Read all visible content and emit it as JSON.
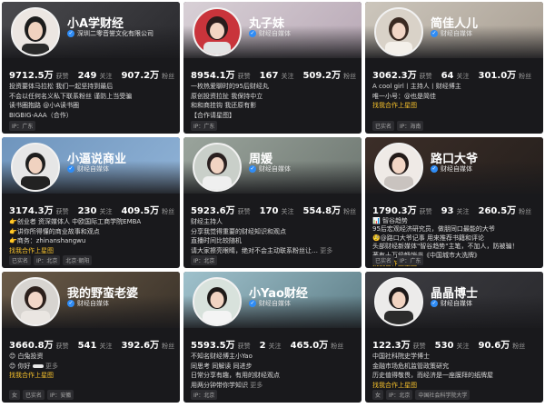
{
  "cards": [
    {
      "name": "小A学财经",
      "verify": "深圳二零音誉文化有限公司",
      "stats": [
        {
          "value": "9712.5万",
          "label": "获赞"
        },
        {
          "value": "249",
          "label": "关注"
        },
        {
          "value": "907.2万",
          "label": "粉丝"
        }
      ],
      "bio": [
        "投资要体马拉松 我们一起坚持到最后",
        "不会以任何名义私下联系粉丝 谨防上当受骗",
        "读书圈抱路 @小A读书圈",
        "BIGBIG-AAA（合作）"
      ],
      "coop": "",
      "tags": [
        "IP：广东"
      ]
    },
    {
      "name": "丸子妹",
      "verify": "财经自媒体",
      "stats": [
        {
          "value": "8954.1万",
          "label": "获赞"
        },
        {
          "value": "167",
          "label": "关注"
        },
        {
          "value": "509.2万",
          "label": "粉丝"
        }
      ],
      "bio": [
        "一枚热爱聊时的95后财经丸",
        "原创投资拉扯 我保持中立",
        "和和商挂钩 我还原有影",
        "【合作请星图】"
      ],
      "coop": "",
      "tags": [
        "IP：广东"
      ]
    },
    {
      "name": "简佳人儿",
      "verify": "财经自媒体",
      "stats": [
        {
          "value": "3062.3万",
          "label": "获赞"
        },
        {
          "value": "64",
          "label": "关注"
        },
        {
          "value": "301.0万",
          "label": "粉丝"
        }
      ],
      "bio": [
        "A cool girl丨主持人丨财经博主",
        "唯一小号：@也是简佳"
      ],
      "coop": "找我合作上星图",
      "tags": [
        "已实名",
        "IP：海南"
      ]
    },
    {
      "name": "小逼说商业",
      "verify": "财经自媒体",
      "stats": [
        {
          "value": "3174.3万",
          "label": "获赞"
        },
        {
          "value": "230",
          "label": "关注"
        },
        {
          "value": "409.5万",
          "label": "粉丝"
        }
      ],
      "bio": [
        "👉创业者 资深媒体人 中欧国际工商学院EMBA",
        "👉讲你所得懂的商业故事和观点",
        "👉商务：zhinanshangwu"
      ],
      "coop": "找我合作上星图",
      "tags": [
        "已实名",
        "IP：北京",
        "北京·朝阳"
      ]
    },
    {
      "name": "周媛",
      "verify": "财经自媒体",
      "stats": [
        {
          "value": "5923.6万",
          "label": "获赞"
        },
        {
          "value": "170",
          "label": "关注"
        },
        {
          "value": "554.8万",
          "label": "粉丝"
        }
      ],
      "bio": [
        "财经主持人",
        "分享我觉得重要的财经知识和观点",
        "直播时间比较随机",
        "请大家擦亮眼睛，绝对不会主动联系粉丝让…"
      ],
      "more": "更多",
      "coop": "",
      "tags": [
        "IP：北京"
      ]
    },
    {
      "name": "路口大爷",
      "verify": "财经自媒体",
      "stats": [
        {
          "value": "1790.3万",
          "label": "获赞"
        },
        {
          "value": "93",
          "label": "关注"
        },
        {
          "value": "260.5万",
          "label": "粉丝"
        }
      ],
      "bio": [
        "📊 智谷趋势",
        "95后宏观经济研究员，做朋同口最能的大爷",
        "🧐@路口大爷记事 用来推荐书籍和评论",
        "头部财经新媒体\"智谷趋势\"主笔，不加人，防被骗！",
        "著有十万级畅销书《中国城市大洗牌》"
      ],
      "coop": "找我合作上星图",
      "tags": [
        "已实名",
        "IP：广东"
      ]
    },
    {
      "name": "我的野蛮老婆",
      "verify": "财经自媒体",
      "stats": [
        {
          "value": "3660.8万",
          "label": "获赞"
        },
        {
          "value": "541",
          "label": "关注"
        },
        {
          "value": "392.6万",
          "label": "粉丝"
        }
      ],
      "bio": [
        "😊 白兔投资",
        "😊 你好",
        "更多"
      ],
      "coop": "找我合作上星图",
      "tags": [
        "女",
        "已实名",
        "IP：安徽"
      ]
    },
    {
      "name": "小Yao财经",
      "verify": "财经自媒体",
      "stats": [
        {
          "value": "5593.5万",
          "label": "获赞"
        },
        {
          "value": "2",
          "label": "关注"
        },
        {
          "value": "465.0万",
          "label": "粉丝"
        }
      ],
      "bio": [
        "不知名财经博主小Yao",
        "同思考 同解读 同进步",
        "日常分享有趣，有用的财经观点",
        "用两分钟带你学知识"
      ],
      "more": "更多",
      "coop": "",
      "tags": [
        "IP：北京"
      ]
    },
    {
      "name": "晶晶博士",
      "verify": "财经自媒体",
      "stats": [
        {
          "value": "122.3万",
          "label": "获赞"
        },
        {
          "value": "530",
          "label": "关注"
        },
        {
          "value": "90.6万",
          "label": "粉丝"
        }
      ],
      "bio": [
        "中国社科院史学博士",
        "金融市场危机监管政策研究",
        "历史值得敬畏，而经济是一座膜拜的纸牌屋",
        "找我合作上星图"
      ],
      "coop": "",
      "tags": [
        "女",
        "IP：北京",
        "中国社会科学院大学"
      ]
    }
  ],
  "colors": {
    "card_bg": "#19191c",
    "verify_blue": "#2f8cf5",
    "coop_gold": "#f6c12b"
  }
}
